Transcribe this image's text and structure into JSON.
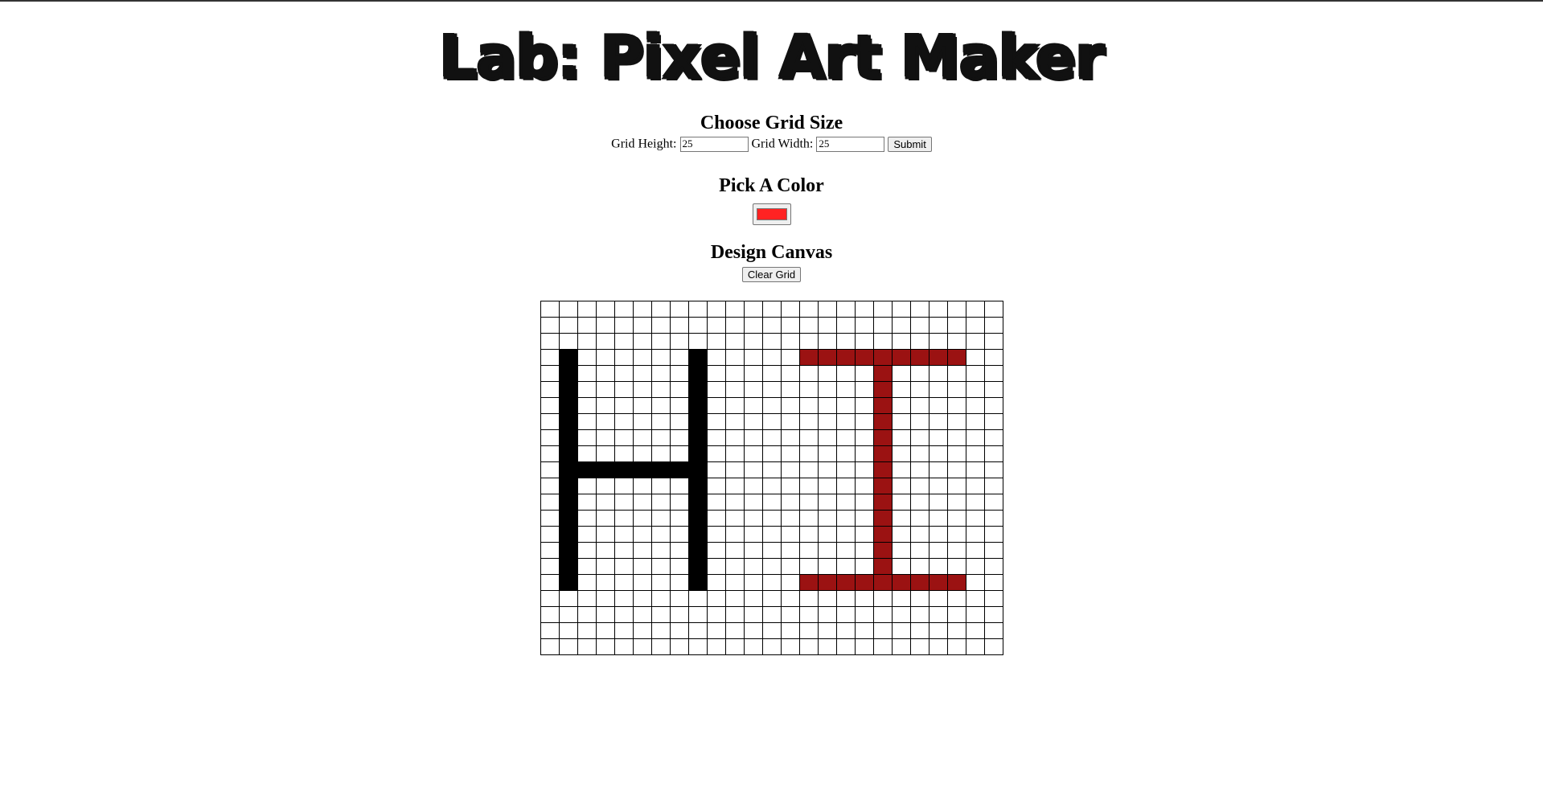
{
  "title": "Lab: Pixel Art Maker",
  "grid_size": {
    "heading": "Choose Grid Size",
    "height_label": "Grid Height:",
    "height_value": "25",
    "width_label": "Grid Width:",
    "width_value": "25",
    "submit_label": "Submit"
  },
  "color_picker": {
    "heading": "Pick A Color",
    "value": "#ff2222"
  },
  "canvas": {
    "heading": "Design Canvas",
    "clear_label": "Clear Grid",
    "rows": 22,
    "cols": 25,
    "empty_color": "#ffffff",
    "painted": [
      {
        "color": "#000000",
        "cells": [
          [
            3,
            1
          ],
          [
            4,
            1
          ],
          [
            5,
            1
          ],
          [
            6,
            1
          ],
          [
            7,
            1
          ],
          [
            8,
            1
          ],
          [
            9,
            1
          ],
          [
            10,
            1
          ],
          [
            11,
            1
          ],
          [
            12,
            1
          ],
          [
            13,
            1
          ],
          [
            14,
            1
          ],
          [
            15,
            1
          ],
          [
            16,
            1
          ],
          [
            17,
            1
          ],
          [
            3,
            8
          ],
          [
            4,
            8
          ],
          [
            5,
            8
          ],
          [
            6,
            8
          ],
          [
            7,
            8
          ],
          [
            8,
            8
          ],
          [
            9,
            8
          ],
          [
            10,
            8
          ],
          [
            11,
            8
          ],
          [
            12,
            8
          ],
          [
            13,
            8
          ],
          [
            14,
            8
          ],
          [
            15,
            8
          ],
          [
            16,
            8
          ],
          [
            17,
            8
          ],
          [
            10,
            2
          ],
          [
            10,
            3
          ],
          [
            10,
            4
          ],
          [
            10,
            5
          ],
          [
            10,
            6
          ],
          [
            10,
            7
          ]
        ]
      },
      {
        "color": "#9b1212",
        "cells": [
          [
            3,
            14
          ],
          [
            3,
            15
          ],
          [
            3,
            16
          ],
          [
            3,
            17
          ],
          [
            3,
            18
          ],
          [
            3,
            19
          ],
          [
            3,
            20
          ],
          [
            3,
            21
          ],
          [
            3,
            22
          ],
          [
            4,
            18
          ],
          [
            5,
            18
          ],
          [
            6,
            18
          ],
          [
            7,
            18
          ],
          [
            8,
            18
          ],
          [
            9,
            18
          ],
          [
            10,
            18
          ],
          [
            11,
            18
          ],
          [
            12,
            18
          ],
          [
            13,
            18
          ],
          [
            14,
            18
          ],
          [
            15,
            18
          ],
          [
            16,
            18
          ],
          [
            17,
            14
          ],
          [
            17,
            15
          ],
          [
            17,
            16
          ],
          [
            17,
            17
          ],
          [
            17,
            18
          ],
          [
            17,
            19
          ],
          [
            17,
            20
          ],
          [
            17,
            21
          ],
          [
            17,
            22
          ]
        ]
      }
    ]
  }
}
